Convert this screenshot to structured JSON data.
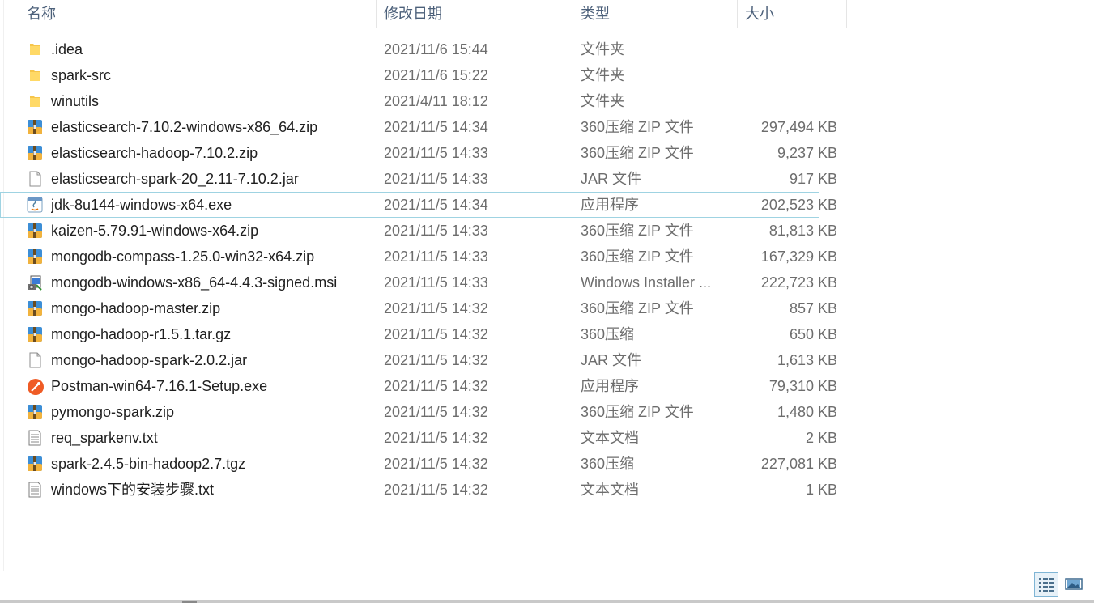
{
  "header": {
    "name": "名称",
    "modified": "修改日期",
    "type": "类型",
    "size": "大小"
  },
  "files": [
    {
      "name": ".idea",
      "date": "2021/11/6 15:44",
      "type": "文件夹",
      "size": "",
      "icon": "folder-icon"
    },
    {
      "name": "spark-src",
      "date": "2021/11/6 15:22",
      "type": "文件夹",
      "size": "",
      "icon": "folder-icon"
    },
    {
      "name": "winutils",
      "date": "2021/4/11 18:12",
      "type": "文件夹",
      "size": "",
      "icon": "folder-icon"
    },
    {
      "name": "elasticsearch-7.10.2-windows-x86_64.zip",
      "date": "2021/11/5 14:34",
      "type": "360压缩 ZIP 文件",
      "size": "297,494 KB",
      "icon": "archive-icon"
    },
    {
      "name": "elasticsearch-hadoop-7.10.2.zip",
      "date": "2021/11/5 14:33",
      "type": "360压缩 ZIP 文件",
      "size": "9,237 KB",
      "icon": "archive-icon"
    },
    {
      "name": "elasticsearch-spark-20_2.11-7.10.2.jar",
      "date": "2021/11/5 14:33",
      "type": "JAR 文件",
      "size": "917 KB",
      "icon": "file-icon"
    },
    {
      "name": "jdk-8u144-windows-x64.exe",
      "date": "2021/11/5 14:34",
      "type": "应用程序",
      "size": "202,523 KB",
      "icon": "java-installer-icon",
      "selected": true
    },
    {
      "name": "kaizen-5.79.91-windows-x64.zip",
      "date": "2021/11/5 14:33",
      "type": "360压缩 ZIP 文件",
      "size": "81,813 KB",
      "icon": "archive-icon"
    },
    {
      "name": "mongodb-compass-1.25.0-win32-x64.zip",
      "date": "2021/11/5 14:33",
      "type": "360压缩 ZIP 文件",
      "size": "167,329 KB",
      "icon": "archive-icon"
    },
    {
      "name": "mongodb-windows-x86_64-4.4.3-signed.msi",
      "date": "2021/11/5 14:33",
      "type": "Windows Installer ...",
      "size": "222,723 KB",
      "icon": "msi-installer-icon"
    },
    {
      "name": "mongo-hadoop-master.zip",
      "date": "2021/11/5 14:32",
      "type": "360压缩 ZIP 文件",
      "size": "857 KB",
      "icon": "archive-icon"
    },
    {
      "name": "mongo-hadoop-r1.5.1.tar.gz",
      "date": "2021/11/5 14:32",
      "type": "360压缩",
      "size": "650 KB",
      "icon": "archive-icon"
    },
    {
      "name": "mongo-hadoop-spark-2.0.2.jar",
      "date": "2021/11/5 14:32",
      "type": "JAR 文件",
      "size": "1,613 KB",
      "icon": "file-icon"
    },
    {
      "name": "Postman-win64-7.16.1-Setup.exe",
      "date": "2021/11/5 14:32",
      "type": "应用程序",
      "size": "79,310 KB",
      "icon": "postman-icon"
    },
    {
      "name": "pymongo-spark.zip",
      "date": "2021/11/5 14:32",
      "type": "360压缩 ZIP 文件",
      "size": "1,480 KB",
      "icon": "archive-icon"
    },
    {
      "name": "req_sparkenv.txt",
      "date": "2021/11/5 14:32",
      "type": "文本文档",
      "size": "2 KB",
      "icon": "text-file-icon"
    },
    {
      "name": "spark-2.4.5-bin-hadoop2.7.tgz",
      "date": "2021/11/5 14:32",
      "type": "360压缩",
      "size": "227,081 KB",
      "icon": "archive-icon"
    },
    {
      "name": "windows下的安装步骤.txt",
      "date": "2021/11/5 14:32",
      "type": "文本文档",
      "size": "1 KB",
      "icon": "text-file-icon"
    }
  ],
  "view_buttons": {
    "details": "details-view-icon",
    "large": "large-icons-view-icon"
  }
}
